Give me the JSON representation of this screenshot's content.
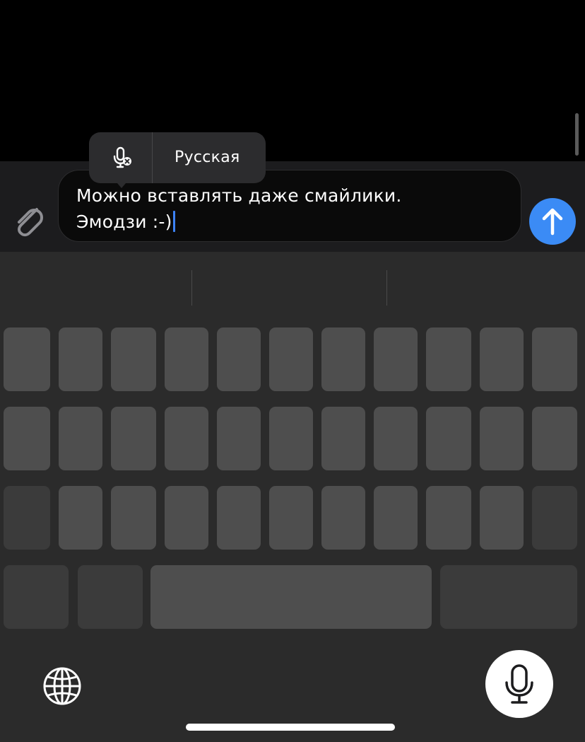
{
  "popup": {
    "language_label": "Русская",
    "mic_icon": "mic-slash-icon"
  },
  "composer": {
    "attach_icon": "paperclip-icon",
    "text_line1": "Можно вставлять даже смайлики.",
    "text_line2": "Эмодзи :-)",
    "send_icon": "arrow-up-icon"
  },
  "keyboard": {
    "globe_icon": "globe-icon",
    "dictation_icon": "microphone-icon"
  },
  "colors": {
    "accent": "#3b8bf5",
    "caret": "#3c82f6",
    "keyboard_bg": "#2b2b2b",
    "key": "#4e4e4e"
  }
}
